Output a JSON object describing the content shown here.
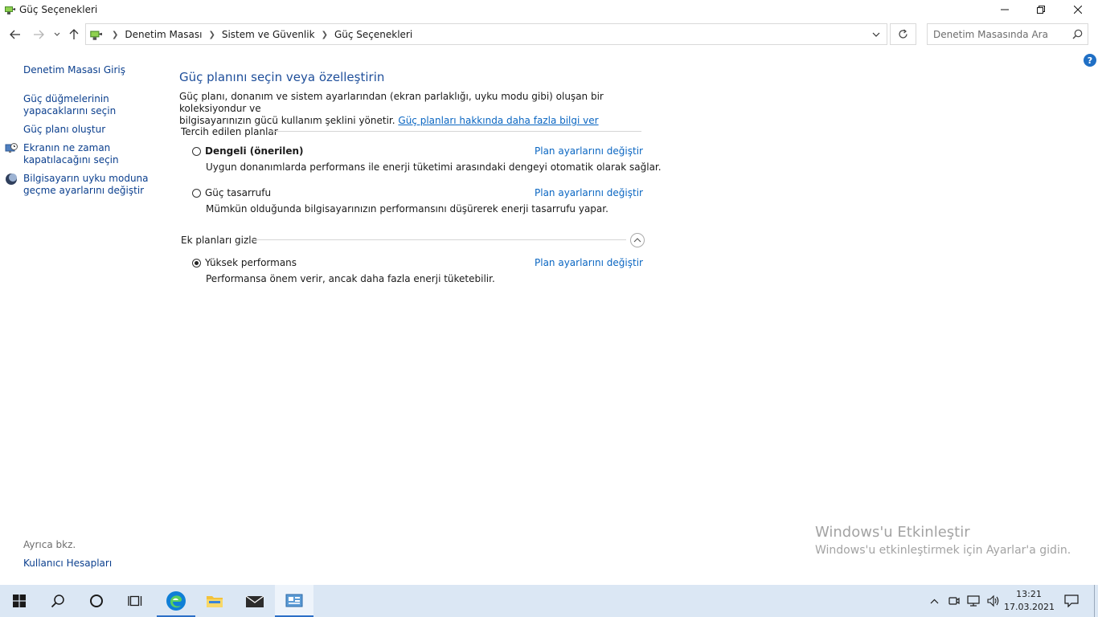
{
  "window": {
    "title": "Güç Seçenekleri"
  },
  "navigation": {
    "breadcrumbs": [
      "Denetim Masası",
      "Sistem ve Güvenlik",
      "Güç Seçenekleri"
    ],
    "search_placeholder": "Denetim Masasında Ara"
  },
  "sidebar": {
    "home_link": "Denetim Masası Giriş",
    "links": [
      {
        "line1": "Güç düğmelerinin",
        "line2": "yapacaklarını seçin",
        "icon": null
      },
      {
        "line1": "Güç planı oluştur",
        "line2": "",
        "icon": null
      },
      {
        "line1": "Ekranın ne zaman",
        "line2": "kapatılacağını seçin",
        "icon": "monitor-clock-icon"
      },
      {
        "line1": "Bilgisayarın uyku moduna",
        "line2": "geçme ayarlarını değiştir",
        "icon": "moon-icon"
      }
    ],
    "see_also_label": "Ayrıca bkz.",
    "see_also_links": [
      "Kullanıcı Hesapları"
    ]
  },
  "main": {
    "heading": "Güç planını seçin veya özelleştirin",
    "description_line1": "Güç planı, donanım ve sistem ayarlarından (ekran parlaklığı, uyku modu gibi) oluşan bir koleksiyondur ve",
    "description_line2": "bilgisayarınızın gücü kullanım şeklini yönetir.",
    "more_info_link": "Güç planları hakkında daha fazla bilgi ver",
    "preferred_header": "Tercih edilen planlar",
    "preferred_plans": [
      {
        "name": "Dengeli (önerilen)",
        "description": "Uygun donanımlarda performans ile enerji tüketimi arasındaki dengeyi otomatik olarak sağlar.",
        "link": "Plan ayarlarını değiştir",
        "selected": false,
        "bold": true
      },
      {
        "name": "Güç tasarrufu",
        "description": "Mümkün olduğunda bilgisayarınızın performansını düşürerek enerji tasarrufu yapar.",
        "link": "Plan ayarlarını değiştir",
        "selected": false,
        "bold": false
      }
    ],
    "hidden_header": "Ek planları gizle",
    "additional_plans": [
      {
        "name": "Yüksek performans",
        "description": "Performansa önem verir, ancak daha fazla enerji tüketebilir.",
        "link": "Plan ayarlarını değiştir",
        "selected": true,
        "bold": false
      }
    ]
  },
  "watermark": {
    "title": "Windows'u Etkinleştir",
    "subtitle": "Windows'u etkinleştirmek için Ayarlar'a gidin."
  },
  "taskbar": {
    "time": "13:21",
    "date": "17.03.2021"
  },
  "colors": {
    "link": "#0a66c2",
    "heading": "#1e4e9a",
    "taskbar": "#dbe7f4"
  }
}
